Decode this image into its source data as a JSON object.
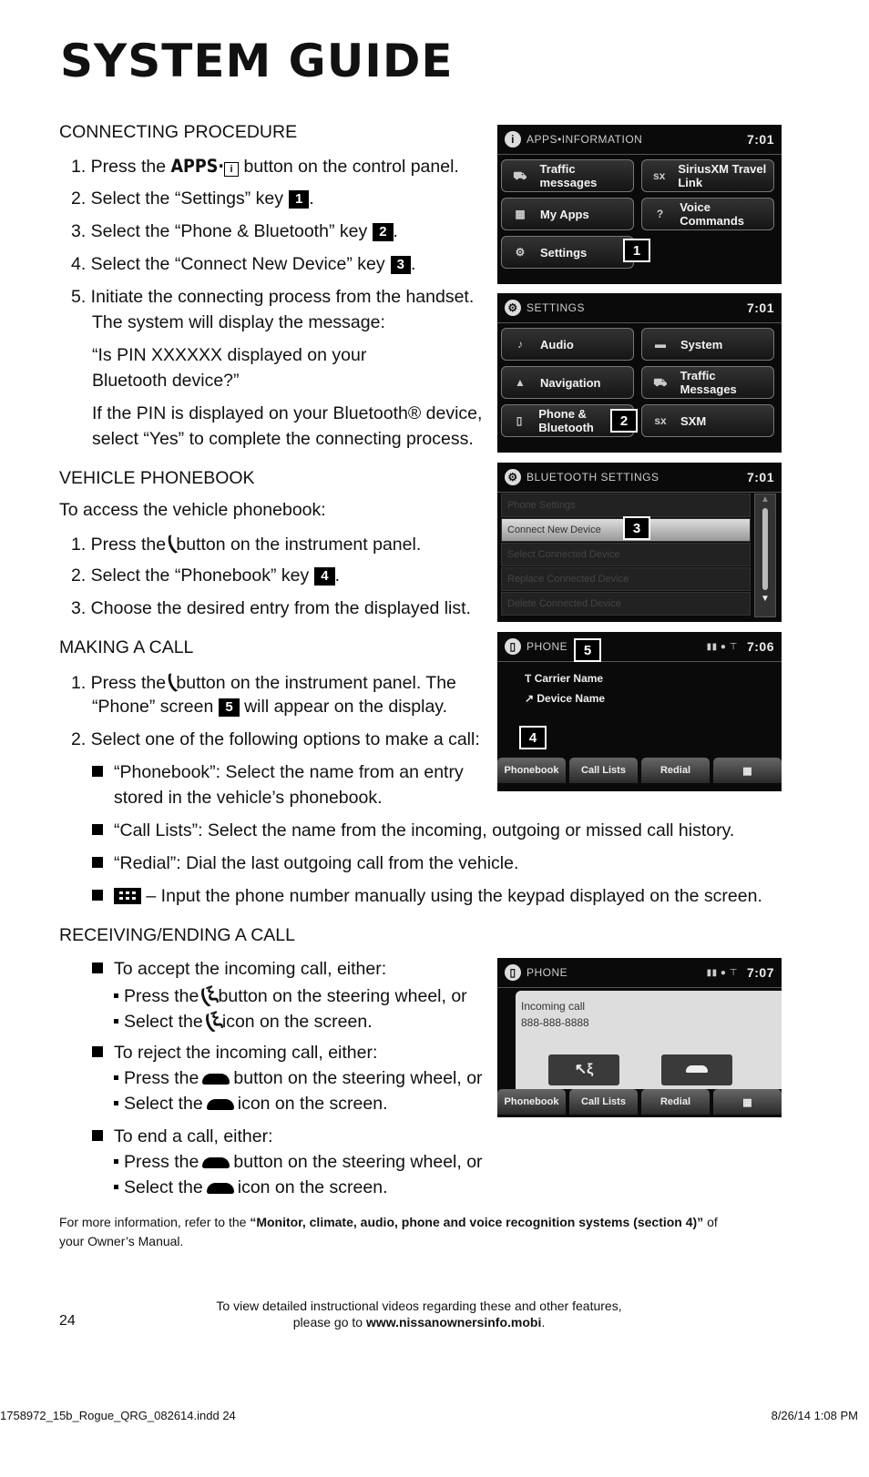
{
  "page_title": "SYSTEM GUIDE",
  "connecting": {
    "heading": "CONNECTING PROCEDURE",
    "step1_a": "1. Press the ",
    "step1_btn": "APPS·",
    "step1_b": " button on the control panel.",
    "step2": "2. Select the “Settings” key",
    "step2_badge": "1",
    "step3": "3. Select the “Phone & Bluetooth” key",
    "step3_badge": "2",
    "step4": "4. Select the “Connect New Device” key",
    "step4_badge": "3",
    "step5_l1": "5. Initiate the connecting process from the handset.",
    "step5_l2": "The system will display the message:",
    "quote_l1": "“Is PIN XXXXXX displayed on your",
    "quote_l2": "Bluetooth device?”",
    "pin_l1": "If the PIN is displayed on your Bluetooth® device,",
    "pin_l2": "select “Yes” to complete the connecting process."
  },
  "phonebook": {
    "heading": "VEHICLE PHONEBOOK",
    "intro": "To access the vehicle phonebook:",
    "step1_a": "1. Press the",
    "step1_b": "button on the instrument panel.",
    "step2": "2. Select the “Phonebook” key",
    "step2_badge": "4",
    "step3": "3. Choose the desired entry from the displayed list."
  },
  "making_call": {
    "heading": "MAKING A CALL",
    "step1_a": "1. Press the",
    "step1_b": "button on the instrument panel. The",
    "step1_c": "“Phone” screen",
    "step1_badge": "5",
    "step1_d": "will appear on the display.",
    "step2": "2. Select one of the following options to make a call:",
    "opt1_l1": "“Phonebook”: Select the name from an entry",
    "opt1_l2": "stored in the vehicle’s phonebook.",
    "opt2": "“Call Lists”: Select the name from the incoming, outgoing or missed call history.",
    "opt3": "“Redial”: Dial the last outgoing call from the vehicle.",
    "opt4": "– Input the phone number manually using the keypad displayed on the screen."
  },
  "receiving": {
    "heading": "RECEIVING/ENDING A CALL",
    "accept": "To accept the incoming call, either:",
    "accept_a1": "Press the",
    "accept_a2": "button on the steering wheel, or",
    "accept_b1": "Select the",
    "accept_b2": "icon on the screen.",
    "reject": "To reject the incoming call, either:",
    "reject_a1": "Press the",
    "reject_a2": "button on the steering wheel, or",
    "reject_b1": "Select the",
    "reject_b2": "icon on the screen.",
    "end": "To end a call, either:",
    "end_a1": "Press the",
    "end_a2": "button on the steering wheel, or",
    "end_b1": "Select the",
    "end_b2": "icon on the screen."
  },
  "more_info": {
    "prefix": "For more information, refer to the ",
    "bold": "“Monitor, climate, audio, phone and voice recognition systems (section 4)”",
    "suffix": " of",
    "line2": "your Owner’s Manual."
  },
  "footer": {
    "page_number": "24",
    "video_l1": "To view detailed instructional videos regarding these and other features,",
    "video_l2a": "please go to ",
    "video_url": "www.nissanownersinfo.mobi",
    "video_l2b": ".",
    "file": "1758972_15b_Rogue_QRG_082614.indd   24",
    "date": "8/26/14   1:08 PM"
  },
  "screens": {
    "apps": {
      "header": "APPS•INFORMATION",
      "time": "7:01",
      "buttons": [
        "Traffic messages",
        "SiriusXM Travel Link",
        "My Apps",
        "Voice Commands",
        "Settings"
      ],
      "callout": "1"
    },
    "settings": {
      "header": "SETTINGS",
      "time": "7:01",
      "buttons": [
        "Audio",
        "System",
        "Navigation",
        "Traffic Messages",
        "Phone & Bluetooth",
        "SXM"
      ],
      "callout": "2"
    },
    "bluetooth": {
      "header": "BLUETOOTH SETTINGS",
      "time": "7:01",
      "rows": [
        "Phone Settings",
        "Connect New Device",
        "Select Connected Device",
        "Replace Connected Device",
        "Delete Connected Device"
      ],
      "callout": "3"
    },
    "phone": {
      "header": "PHONE",
      "time": "7:06",
      "carrier": "Carrier Name",
      "device": "Device Name",
      "tabs": [
        "Phonebook",
        "Call Lists",
        "Redial",
        "▦"
      ],
      "callout_top": "5",
      "callout_bottom": "4"
    },
    "incoming": {
      "header": "PHONE",
      "time": "7:07",
      "label": "Incoming call",
      "number": "888-888-8888",
      "tabs": [
        "Phonebook",
        "Call Lists",
        "Redial",
        "▦"
      ]
    }
  }
}
